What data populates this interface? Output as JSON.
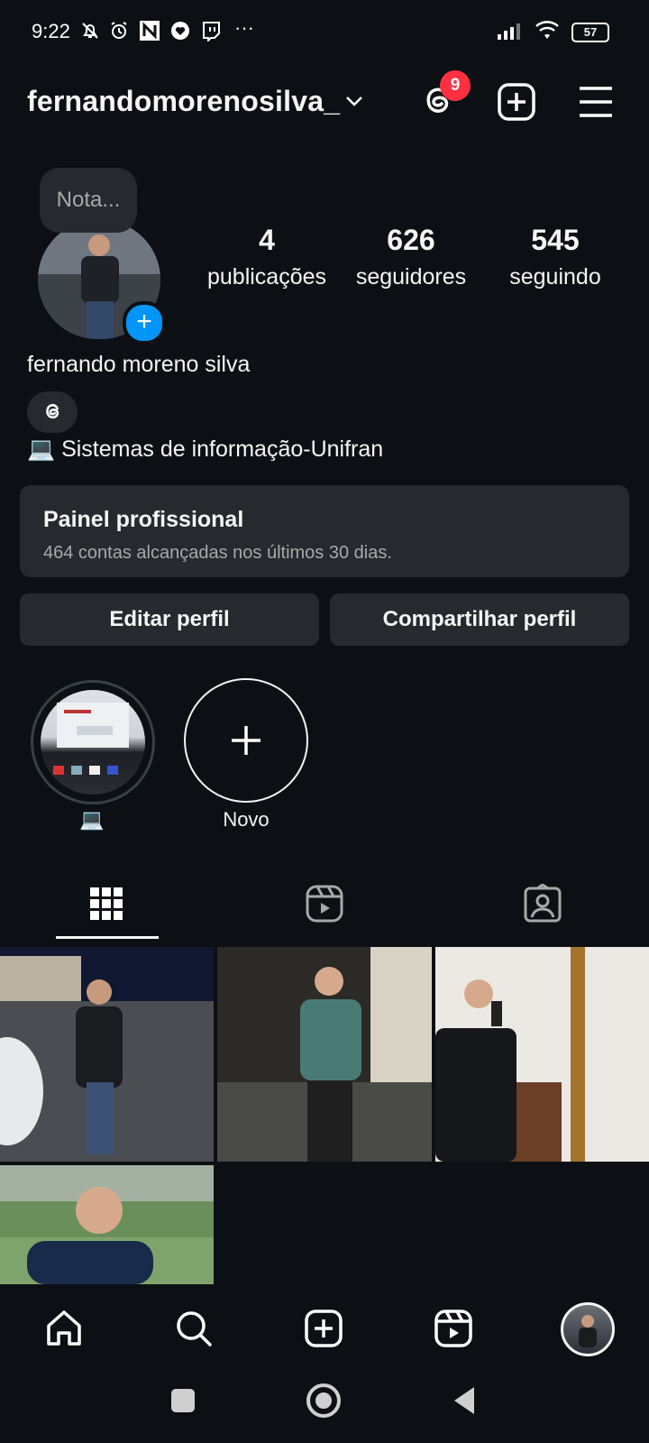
{
  "status_bar": {
    "time": "9:22",
    "more": "···",
    "battery": "57",
    "icons": [
      "muted-bell-icon",
      "alarm-icon",
      "n-app-icon",
      "heart-app-icon",
      "twitch-icon",
      "signal-icon",
      "wifi-icon",
      "battery-icon"
    ]
  },
  "header": {
    "username": "fernandomorenosilva_",
    "threads_badge": "9"
  },
  "profile": {
    "note_placeholder": "Nota...",
    "stats": [
      {
        "value": "4",
        "label": "publicações"
      },
      {
        "value": "626",
        "label": "seguidores"
      },
      {
        "value": "545",
        "label": "seguindo"
      }
    ],
    "full_name": "fernando moreno silva",
    "bio": "💻 Sistemas de informação-Unifran"
  },
  "dashboard": {
    "title": "Painel profissional",
    "subtitle": "464 contas alcançadas nos últimos 30 dias."
  },
  "actions": {
    "edit": "Editar perfil",
    "share": "Compartilhar perfil"
  },
  "highlights": [
    {
      "label": "💻"
    },
    {
      "label": "Novo"
    }
  ],
  "tabs": [
    "grid-icon",
    "reels-icon",
    "tagged-icon"
  ],
  "bottom_nav": [
    "home-icon",
    "search-icon",
    "create-icon",
    "reels-icon",
    "profile-avatar"
  ]
}
